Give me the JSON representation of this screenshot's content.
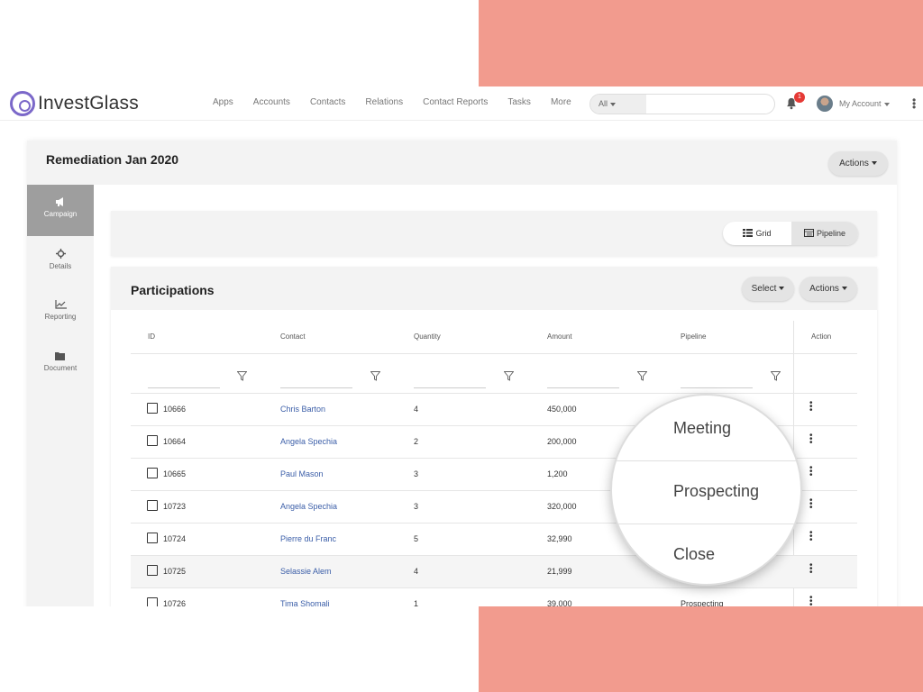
{
  "brand": {
    "name": "InvestGlass"
  },
  "nav": {
    "links": [
      "Apps",
      "Accounts",
      "Contacts",
      "Relations",
      "Contact Reports",
      "Tasks",
      "More"
    ],
    "search_scope": "All",
    "notifications": "1",
    "account_label": "My Account"
  },
  "card": {
    "title": "Remediation Jan 2020",
    "actions_label": "Actions"
  },
  "sidebar": {
    "items": [
      {
        "label": "Campaign",
        "icon": "megaphone-icon"
      },
      {
        "label": "Details",
        "icon": "crosshair-icon"
      },
      {
        "label": "Reporting",
        "icon": "line-chart-icon"
      },
      {
        "label": "Document",
        "icon": "folder-icon"
      }
    ]
  },
  "view_switch": {
    "grid_label": "Grid",
    "pipeline_label": "Pipeline"
  },
  "participations": {
    "title": "Participations",
    "select_label": "Select",
    "actions_label": "Actions",
    "columns": [
      "ID",
      "Contact",
      "Quantity",
      "Amount",
      "Pipeline",
      "Action"
    ],
    "rows": [
      {
        "id": "10666",
        "contact": "Chris Barton",
        "quantity": "4",
        "amount": "450,000",
        "pipeline": ""
      },
      {
        "id": "10664",
        "contact": "Angela Spechia",
        "quantity": "2",
        "amount": "200,000",
        "pipeline": ""
      },
      {
        "id": "10665",
        "contact": "Paul Mason",
        "quantity": "3",
        "amount": "1,200",
        "pipeline": ""
      },
      {
        "id": "10723",
        "contact": "Angela Spechia",
        "quantity": "3",
        "amount": "320,000",
        "pipeline": ""
      },
      {
        "id": "10724",
        "contact": "Pierre du Franc",
        "quantity": "5",
        "amount": "32,990",
        "pipeline": ""
      },
      {
        "id": "10725",
        "contact": "Selassie Alem",
        "quantity": "4",
        "amount": "21,999",
        "pipeline": ""
      },
      {
        "id": "10726",
        "contact": "Tima Shomali",
        "quantity": "1",
        "amount": "39,000",
        "pipeline": "Prospecting"
      }
    ]
  },
  "magnifier": {
    "options": [
      "Meeting",
      "Prospecting",
      "Close"
    ]
  },
  "colors": {
    "accent_deco": "#f29b8e",
    "brand": "#7b68c9",
    "link": "#3b5ea8",
    "badge": "#e53935"
  }
}
